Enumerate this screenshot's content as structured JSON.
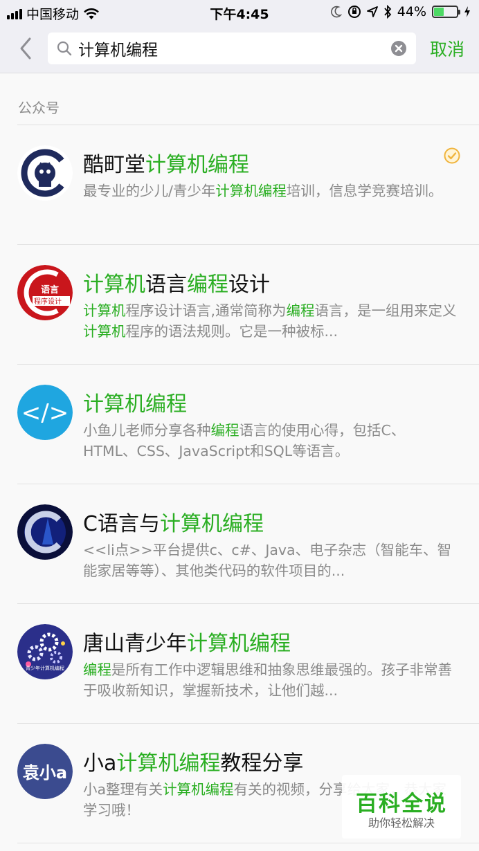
{
  "status_bar": {
    "carrier": "中国移动",
    "time": "下午4:45",
    "battery_text": "44%",
    "battery_level": 0.44
  },
  "search": {
    "query": "计算机编程",
    "cancel_label": "取消"
  },
  "section_label": "公众号",
  "results": [
    {
      "title": [
        {
          "t": "酷町堂",
          "h": false
        },
        {
          "t": "计算机编程",
          "h": true
        }
      ],
      "desc": [
        {
          "t": "最专业的少儿/青少年",
          "h": false
        },
        {
          "t": "计算机编程",
          "h": true
        },
        {
          "t": "培训，信息学竞赛培训。",
          "h": false
        }
      ],
      "verified": true,
      "avatar": "kudingtang"
    },
    {
      "title": [
        {
          "t": "计算机",
          "h": true
        },
        {
          "t": "语言",
          "h": false
        },
        {
          "t": "编程",
          "h": true
        },
        {
          "t": "设计",
          "h": false
        }
      ],
      "desc": [
        {
          "t": "计算机",
          "h": true
        },
        {
          "t": "程序设计语言,通常简称为",
          "h": false
        },
        {
          "t": "编程",
          "h": true
        },
        {
          "t": "语言，是一组用来定义",
          "h": false
        },
        {
          "t": "计算机",
          "h": true
        },
        {
          "t": "程序的语法规则。它是一种被标...",
          "h": false
        }
      ],
      "verified": false,
      "avatar": "c-language",
      "avatar_text": [
        "语言",
        "程序设计"
      ]
    },
    {
      "title": [
        {
          "t": "计算机编程",
          "h": true
        }
      ],
      "desc": [
        {
          "t": "小鱼儿老师分享各种",
          "h": false
        },
        {
          "t": "编程",
          "h": true
        },
        {
          "t": "语言的使用心得，包括C、HTML、CSS、JavaScript和SQL等语言。",
          "h": false
        }
      ],
      "verified": false,
      "avatar": "code-tag",
      "avatar_text": [
        "</>"
      ]
    },
    {
      "title": [
        {
          "t": "C语言与",
          "h": false
        },
        {
          "t": "计算机编程",
          "h": true
        }
      ],
      "desc": [
        {
          "t": "<<li点>>平台提供c、c#、Java、电子杂志（智能车、智能家居等等）、其他类代码的软件项目的...",
          "h": false
        }
      ],
      "verified": false,
      "avatar": "c-blue"
    },
    {
      "title": [
        {
          "t": "唐山青少年",
          "h": false
        },
        {
          "t": "计算机编程",
          "h": true
        }
      ],
      "desc": [
        {
          "t": "编程",
          "h": true
        },
        {
          "t": "是所有工作中逻辑思维和抽象思维最强的。孩子非常善于吸收新知识，掌握新技术，让他们越...",
          "h": false
        }
      ],
      "verified": false,
      "avatar": "gears",
      "avatar_text": [
        "青少年计算机编程"
      ]
    },
    {
      "title": [
        {
          "t": "小a",
          "h": false
        },
        {
          "t": "计算机编程",
          "h": true
        },
        {
          "t": "教程分享",
          "h": false
        }
      ],
      "desc": [
        {
          "t": "小a整理有关",
          "h": false
        },
        {
          "t": "计算机编程",
          "h": true
        },
        {
          "t": "有关的视频，分享给大家，恭大家学习哦！",
          "h": false
        }
      ],
      "verified": false,
      "avatar": "xiaoa",
      "avatar_text": [
        "袁小a"
      ]
    }
  ],
  "watermark": {
    "title": "百科全说",
    "subtitle": "助你轻松解决"
  },
  "colors": {
    "accent": "#2aae22",
    "secondary_text": "#8a8a8a",
    "header_bg": "#efeff4"
  }
}
